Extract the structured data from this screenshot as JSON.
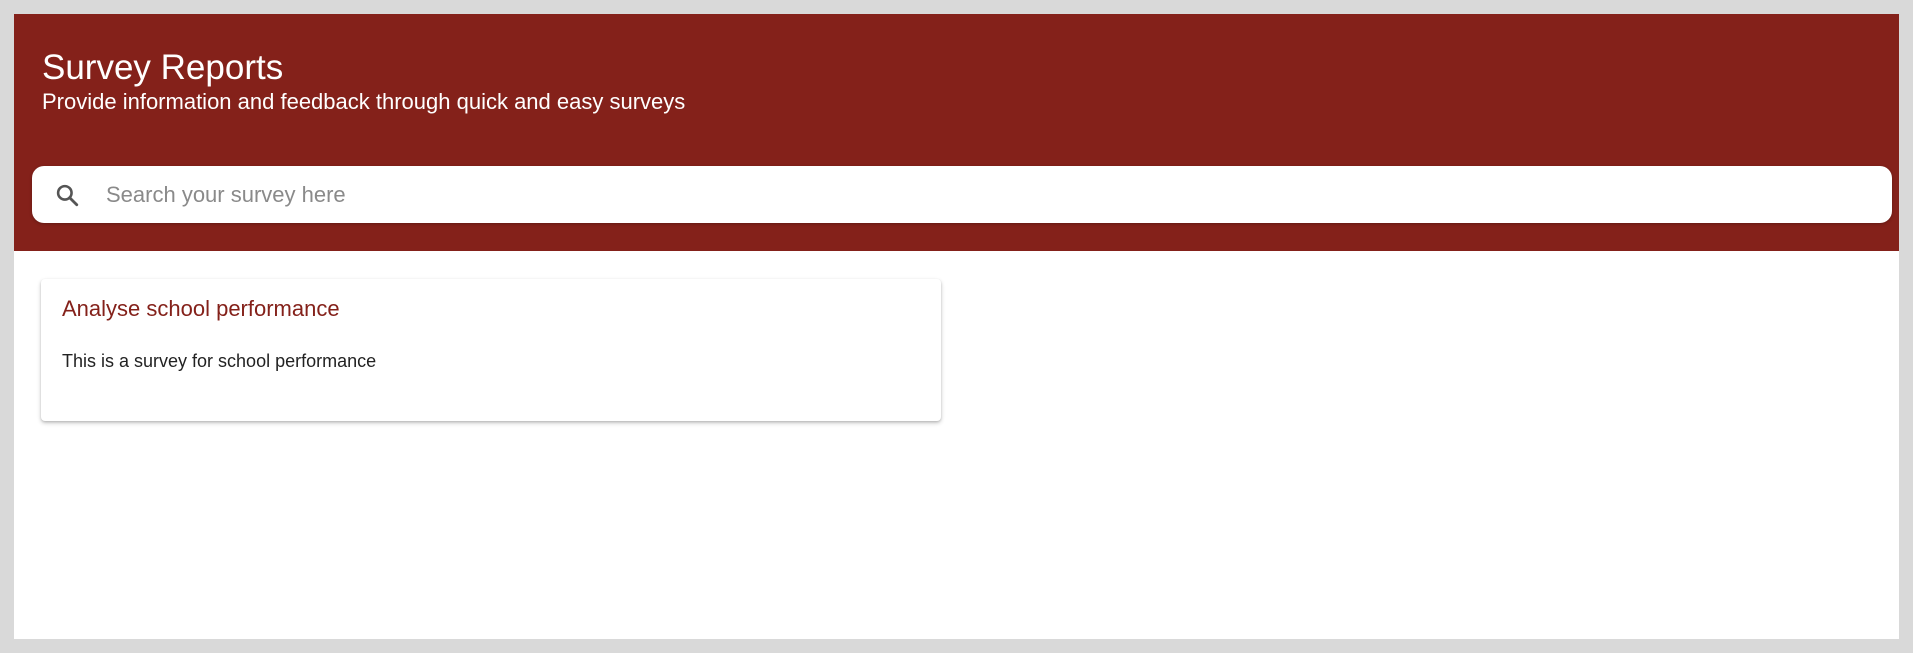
{
  "header": {
    "title": "Survey Reports",
    "subtitle": "Provide information and feedback through quick and easy surveys"
  },
  "search": {
    "icon": "search-icon",
    "placeholder": "Search your survey here",
    "value": ""
  },
  "surveys": [
    {
      "title": "Analyse school performance",
      "description": "This is a survey for school performance"
    }
  ],
  "colors": {
    "brand": "#84211a",
    "background": "#ffffff",
    "outer_frame": "#d9d9d9"
  }
}
